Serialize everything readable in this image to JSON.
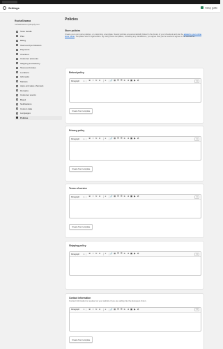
{
  "topbar": {
    "logo_text": "shopify"
  },
  "settings_bar": {
    "title": "Settings",
    "setup_guide_label": "Setup guide",
    "close_label": "✕"
  },
  "sidebar": {
    "store_name": "RuchaShwana",
    "store_domain": "ruchashwana.myshopify.com",
    "items": [
      {
        "label": "Store details",
        "icon": "store-icon"
      },
      {
        "label": "Plan",
        "icon": "plan-icon"
      },
      {
        "label": "Billing",
        "icon": "billing-icon"
      },
      {
        "label": "Users and permissions",
        "icon": "users-icon"
      },
      {
        "label": "Payments",
        "icon": "payments-icon"
      },
      {
        "label": "Checkout",
        "icon": "checkout-icon"
      },
      {
        "label": "Customer accounts",
        "icon": "customer-accounts-icon"
      },
      {
        "label": "Shipping and delivery",
        "icon": "shipping-icon"
      },
      {
        "label": "Taxes and duties",
        "icon": "taxes-icon"
      },
      {
        "label": "Locations",
        "icon": "location-icon"
      },
      {
        "label": "Gift cards",
        "icon": "gift-card-icon"
      },
      {
        "label": "Markets",
        "icon": "markets-icon"
      },
      {
        "label": "Apps and sales channels",
        "icon": "apps-icon"
      },
      {
        "label": "Domains",
        "icon": "domains-icon"
      },
      {
        "label": "Customer events",
        "icon": "customer-events-icon"
      },
      {
        "label": "Brand",
        "icon": "brand-icon"
      },
      {
        "label": "Notifications",
        "icon": "notifications-icon"
      },
      {
        "label": "Custom data",
        "icon": "custom-data-icon"
      },
      {
        "label": "Languages",
        "icon": "languages-icon"
      },
      {
        "label": "Policies",
        "icon": "policies-icon",
        "active": true
      }
    ]
  },
  "main": {
    "page_title": "Policies",
    "intro": {
      "heading": "Store policies",
      "text_before_link": "Create your own store policies, or customize a template. Saved policies are automatically linked in the footer of your checkout and can be ",
      "link_text": "added to your online store menu",
      "text_after_link": ". Templates aren't legal advice. By using these templates, including any translations, you agree that you've read and agree to the disclaimer."
    },
    "editor_toolbar": {
      "format_select": "Paragraph",
      "format_chevron": "▾",
      "bold": "B",
      "italic": "I",
      "underline": "U",
      "color": "A",
      "align": "≡",
      "link": "🔗",
      "table": "⊞",
      "list_bullet": "☰",
      "list_number": "☰",
      "indent_less": "⇤",
      "indent_more": "⇥",
      "image": "▣",
      "video": "▶",
      "clear": "⊘",
      "html": "<>"
    },
    "create_button_label": "Create from template",
    "policies": [
      {
        "title": "Refund policy",
        "has_button": true
      },
      {
        "title": "Privacy policy",
        "has_button": true
      },
      {
        "title": "Terms of service",
        "has_button": true
      },
      {
        "title": "Shipping policy",
        "has_button": false
      },
      {
        "title": "Contact information",
        "description": "Contact information is required on your website if you are selling into the European Union.",
        "has_button": true
      }
    ]
  }
}
